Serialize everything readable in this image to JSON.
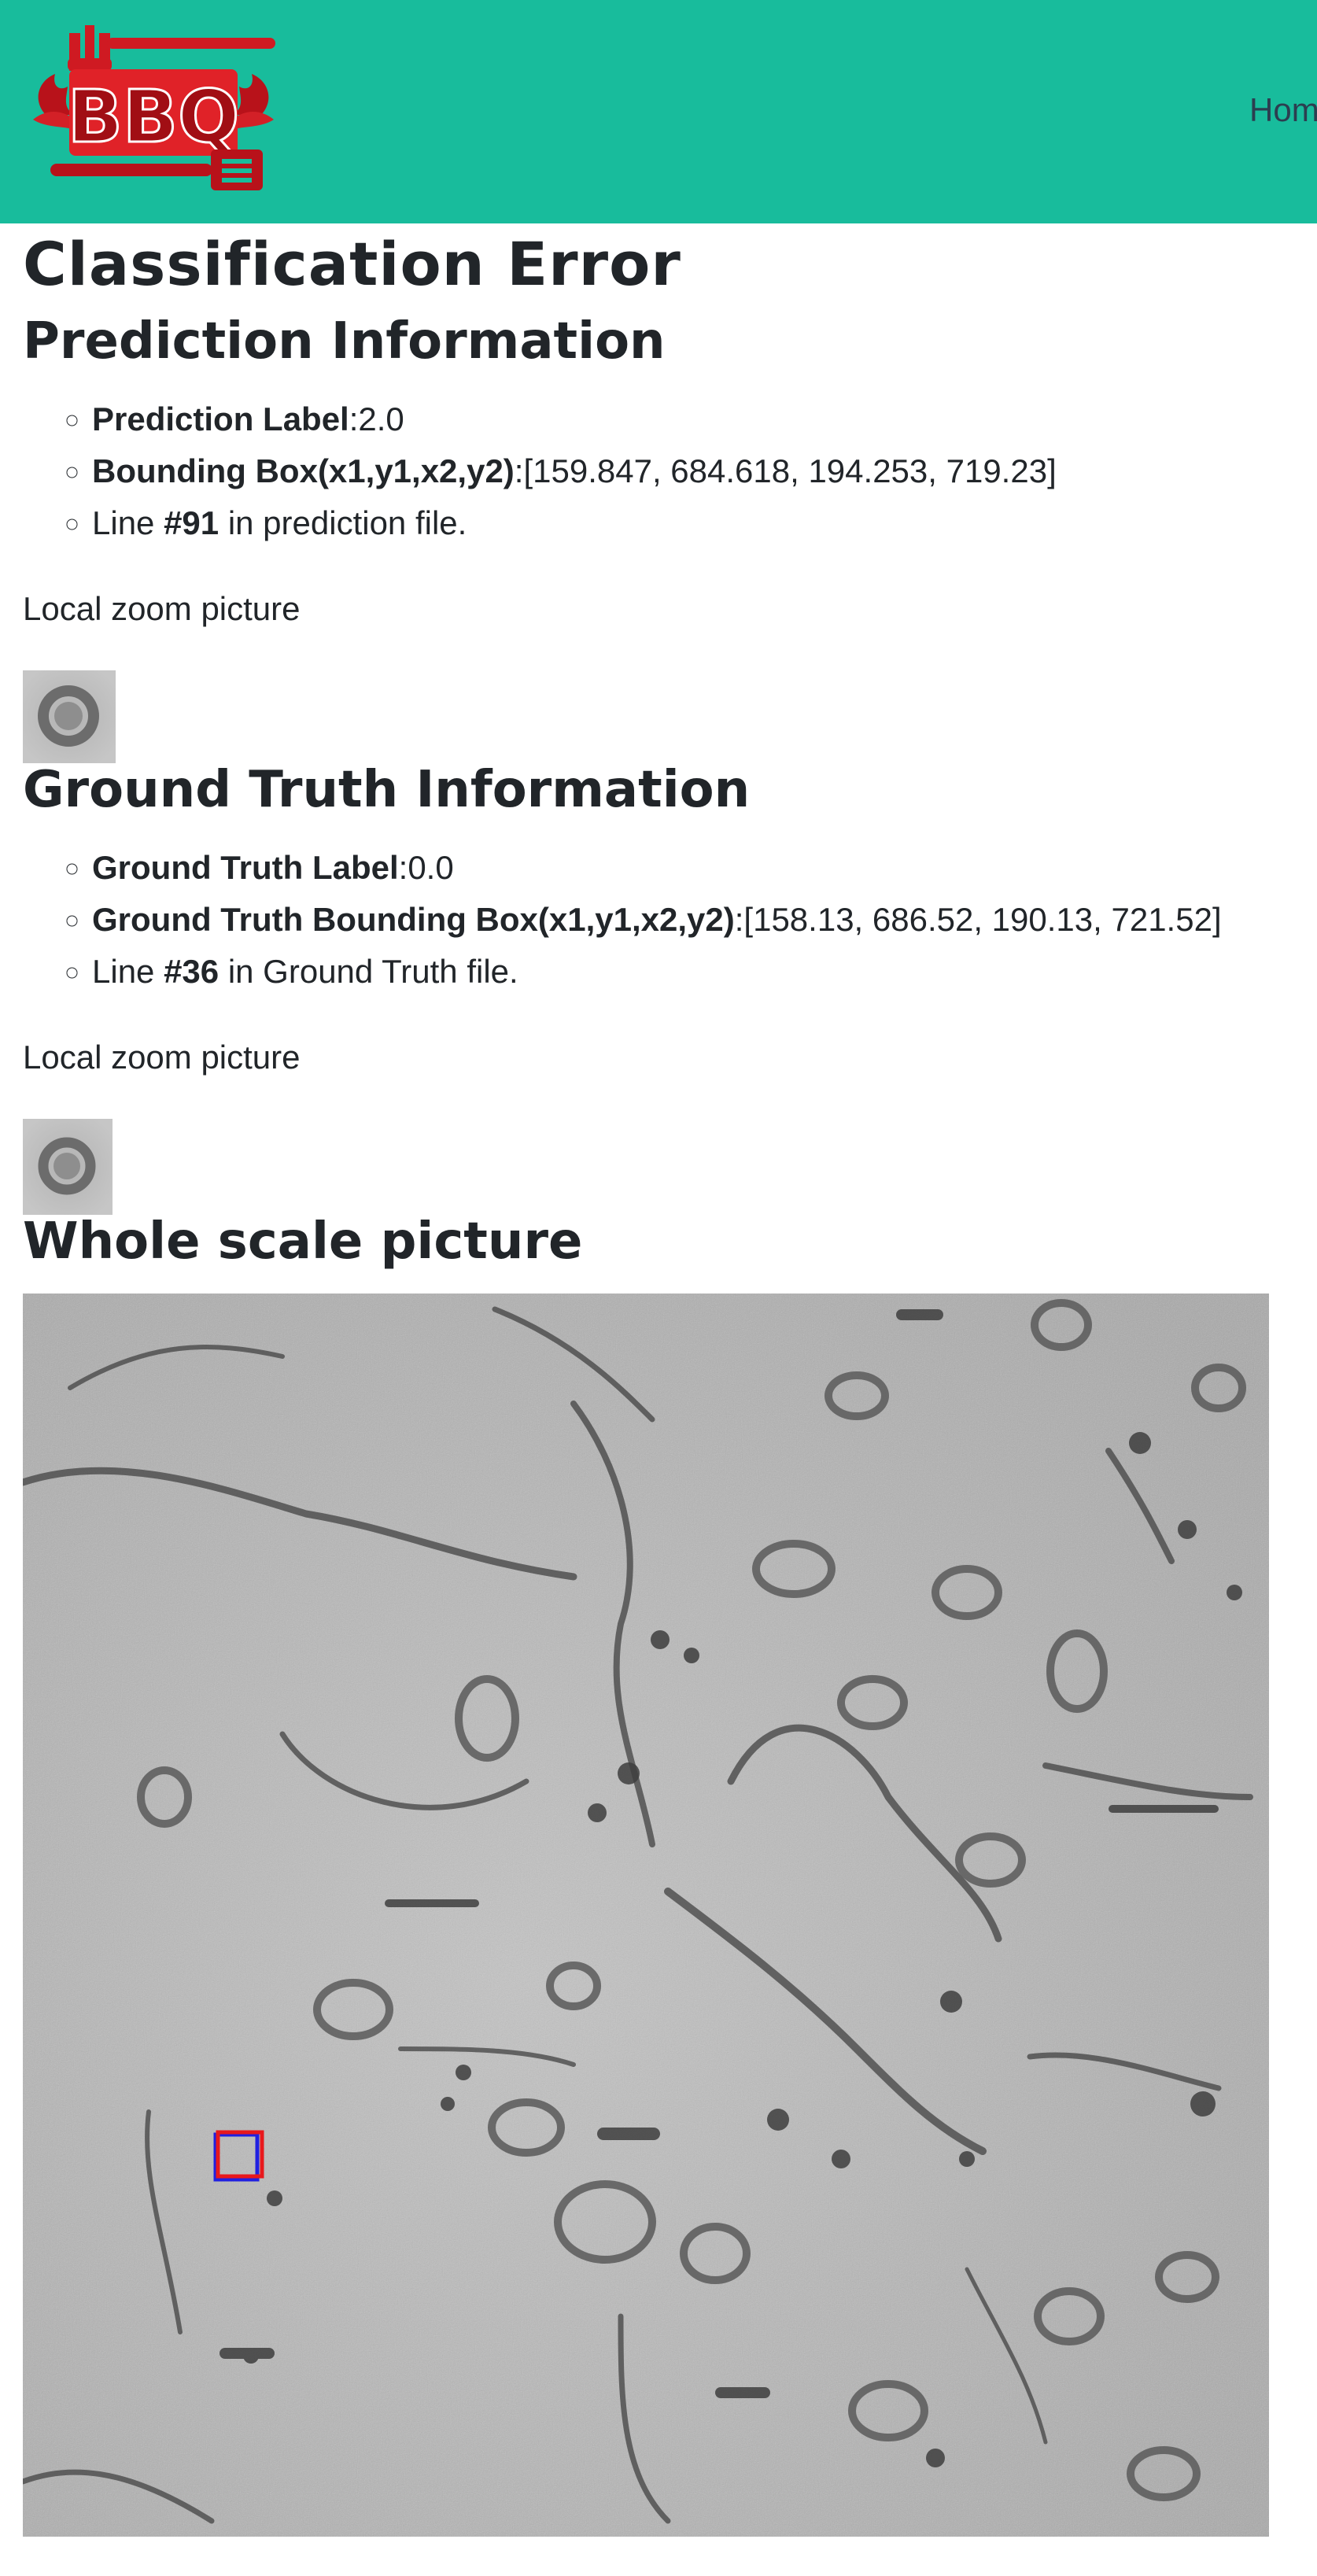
{
  "header": {
    "logo_text": "BBQ",
    "nav_home_label": "Hom"
  },
  "page_title": "Classification Error",
  "prediction": {
    "heading": "Prediction Information",
    "label_key": "Prediction Label",
    "label_value": ":2.0",
    "bbox_key": "Bounding Box(x1,y1,x2,y2)",
    "bbox_value": ":[159.847, 684.618, 194.253, 719.23]",
    "line_prefix": "Line ",
    "line_number": "#91",
    "line_suffix": " in prediction file.",
    "zoom_caption": "Local zoom picture"
  },
  "ground_truth": {
    "heading": "Ground Truth Information",
    "label_key": "Ground Truth Label",
    "label_value": ":0.0",
    "bbox_key": "Ground Truth Bounding Box(x1,y1,x2,y2)",
    "bbox_value": ":[158.13, 686.52, 190.13, 721.52]",
    "line_prefix": "Line ",
    "line_number": "#36",
    "line_suffix": " in Ground Truth file.",
    "zoom_caption": "Local zoom picture"
  },
  "whole_scale": {
    "heading": "Whole scale picture"
  },
  "colors": {
    "header_bg": "#18bc9c",
    "logo_red": "#d01820",
    "prediction_box": "#e8181c",
    "ground_truth_box": "#2020e0"
  }
}
